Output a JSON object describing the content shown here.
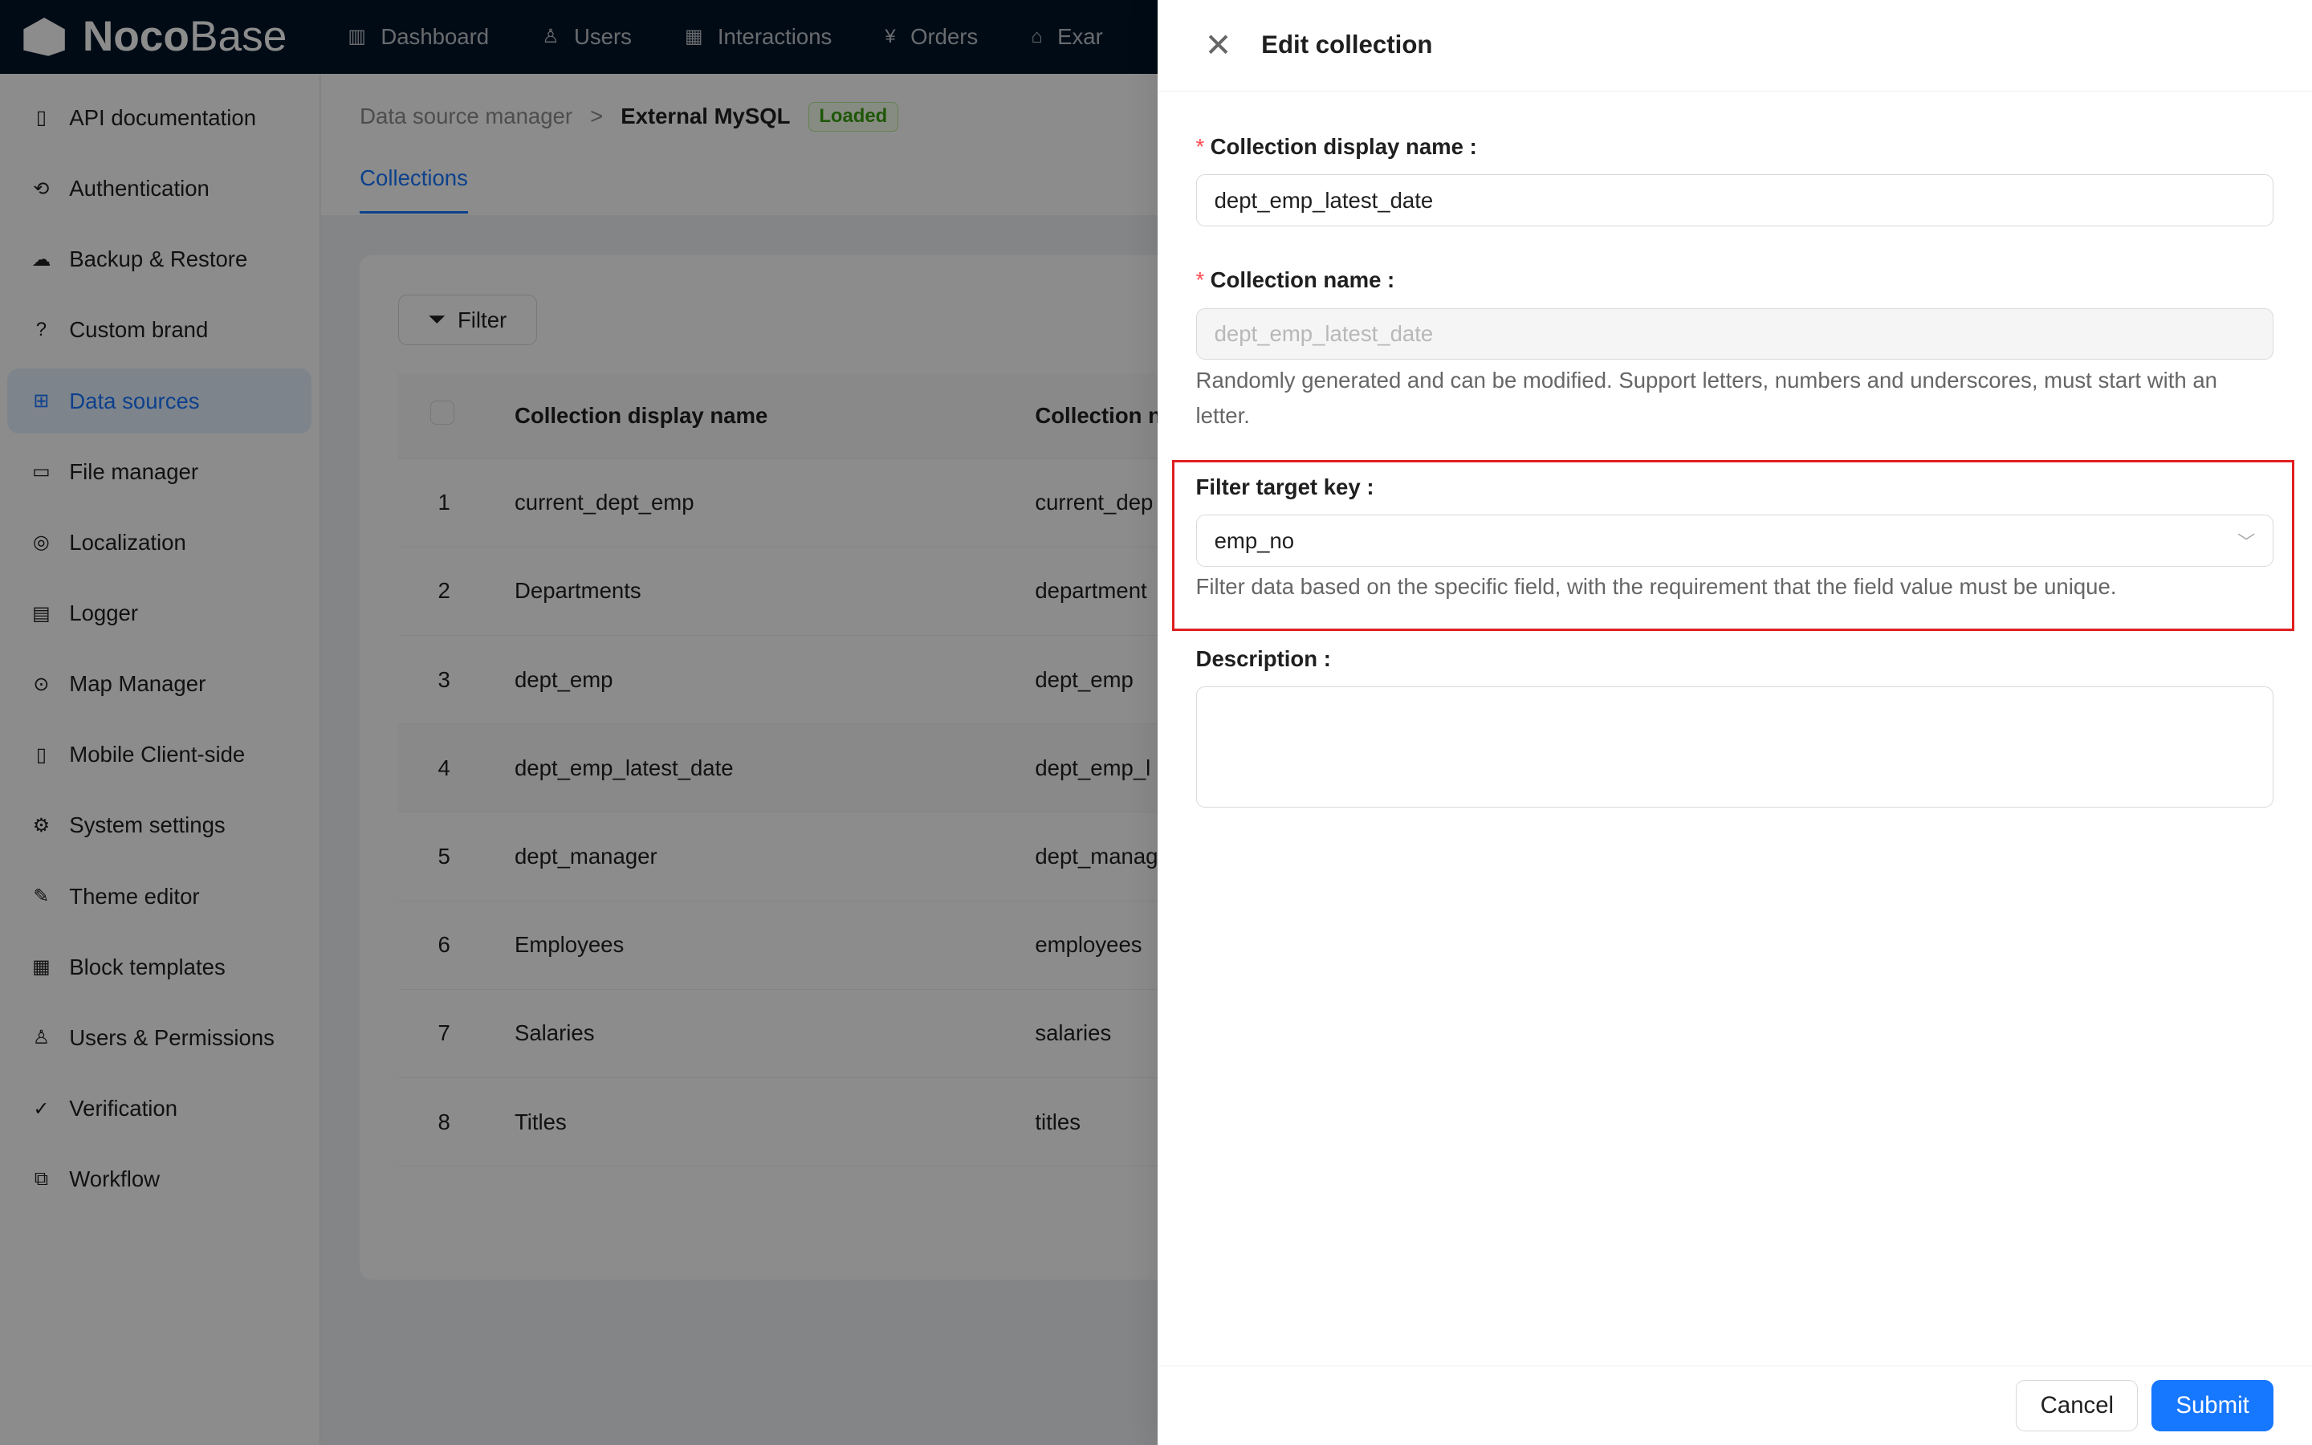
{
  "app": {
    "logo_bold": "Noco",
    "logo_light": "Base"
  },
  "topnav": [
    {
      "label": "Dashboard",
      "icon": "bar-chart-icon"
    },
    {
      "label": "Users",
      "icon": "user-icon"
    },
    {
      "label": "Interactions",
      "icon": "calendar-icon"
    },
    {
      "label": "Orders",
      "icon": "yen-calendar-icon"
    },
    {
      "label": "Exar",
      "icon": "bank-icon"
    }
  ],
  "sidebar": {
    "items": [
      {
        "label": "API documentation"
      },
      {
        "label": "Authentication"
      },
      {
        "label": "Backup & Restore"
      },
      {
        "label": "Custom brand"
      },
      {
        "label": "Data sources",
        "active": true
      },
      {
        "label": "File manager"
      },
      {
        "label": "Localization"
      },
      {
        "label": "Logger"
      },
      {
        "label": "Map Manager"
      },
      {
        "label": "Mobile Client-side"
      },
      {
        "label": "System settings"
      },
      {
        "label": "Theme editor"
      },
      {
        "label": "Block templates"
      },
      {
        "label": "Users & Permissions"
      },
      {
        "label": "Verification"
      },
      {
        "label": "Workflow"
      }
    ]
  },
  "breadcrumb": {
    "parent": "Data source manager",
    "current": "External MySQL",
    "status": "Loaded"
  },
  "tabs": [
    "Collections"
  ],
  "filter_label": "Filter",
  "table": {
    "headers": [
      "Collection display name",
      "Collection n"
    ],
    "rows": [
      [
        "1",
        "current_dept_emp",
        "current_dep"
      ],
      [
        "2",
        "Departments",
        "department"
      ],
      [
        "3",
        "dept_emp",
        "dept_emp"
      ],
      [
        "4",
        "dept_emp_latest_date",
        "dept_emp_l"
      ],
      [
        "5",
        "dept_manager",
        "dept_manag"
      ],
      [
        "6",
        "Employees",
        "employees"
      ],
      [
        "7",
        "Salaries",
        "salaries"
      ],
      [
        "8",
        "Titles",
        "titles"
      ]
    ]
  },
  "drawer": {
    "title": "Edit collection",
    "display_name_label": "Collection display name",
    "display_name_value": "dept_emp_latest_date",
    "name_label": "Collection name",
    "name_value": "dept_emp_latest_date",
    "name_help": "Randomly generated and can be modified. Support letters, numbers and underscores, must start with an letter.",
    "filter_key_label": "Filter target key",
    "filter_key_value": "emp_no",
    "filter_key_help": "Filter data based on the specific field, with the requirement that the field value must be unique.",
    "description_label": "Description",
    "description_value": "",
    "cancel": "Cancel",
    "submit": "Submit"
  },
  "colors": {
    "primary": "#1677ff",
    "highlight": "#e02020",
    "header": "#001529"
  }
}
